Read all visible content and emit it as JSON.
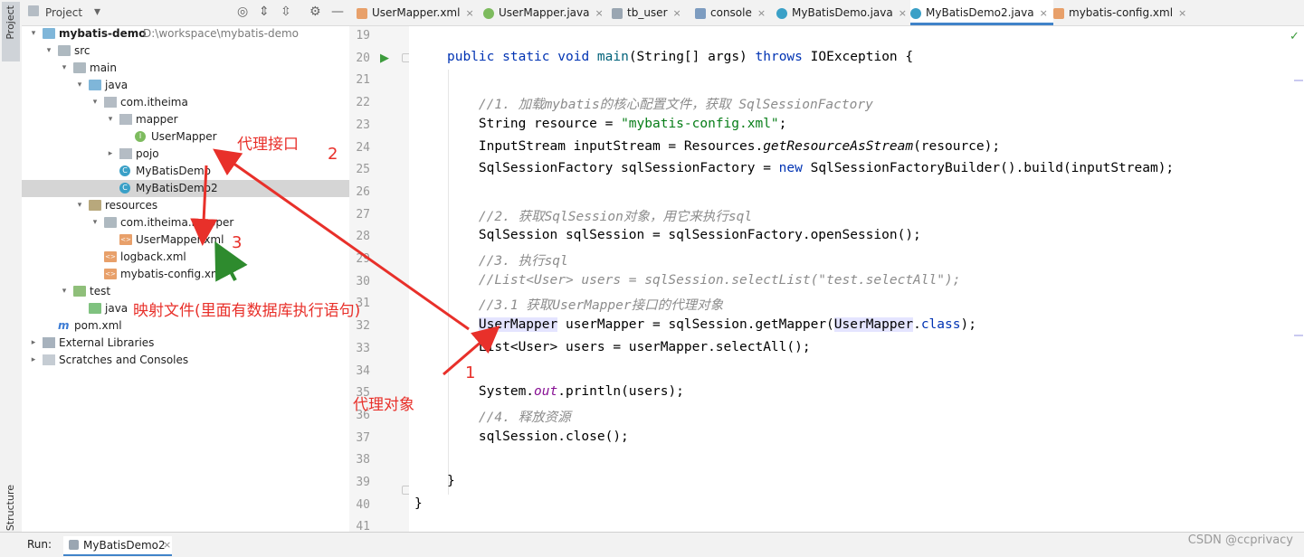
{
  "left_strip": {
    "project_label": "Project",
    "structure_label": "Structure"
  },
  "project_panel": {
    "title": "Project",
    "tree": [
      {
        "label": "mybatis-demo",
        "path": "D:\\workspace\\mybatis-demo",
        "depth": 0,
        "expanded": "open",
        "icon": "module-folder-icon"
      },
      {
        "label": "src",
        "depth": 1,
        "expanded": "open",
        "icon": "folder-icon"
      },
      {
        "label": "main",
        "depth": 2,
        "expanded": "open",
        "icon": "folder-icon"
      },
      {
        "label": "java",
        "depth": 3,
        "expanded": "open",
        "icon": "source-folder-icon"
      },
      {
        "label": "com.itheima",
        "depth": 4,
        "expanded": "open",
        "icon": "package-icon"
      },
      {
        "label": "mapper",
        "depth": 5,
        "expanded": "open",
        "icon": "package-icon"
      },
      {
        "label": "UserMapper",
        "depth": 6,
        "expanded": "none",
        "icon": "interface-icon"
      },
      {
        "label": "pojo",
        "depth": 5,
        "expanded": "closed",
        "icon": "package-icon"
      },
      {
        "label": "MyBatisDemo",
        "depth": 5,
        "expanded": "none",
        "icon": "class-icon"
      },
      {
        "label": "MyBatisDemo2",
        "depth": 5,
        "expanded": "none",
        "icon": "class-icon",
        "selected": true
      },
      {
        "label": "resources",
        "depth": 3,
        "expanded": "open",
        "icon": "resources-folder-icon"
      },
      {
        "label": "com.itheima.mapper",
        "depth": 4,
        "expanded": "open",
        "icon": "folder-icon"
      },
      {
        "label": "UserMapper.xml",
        "depth": 5,
        "expanded": "none",
        "icon": "xml-file-icon"
      },
      {
        "label": "logback.xml",
        "depth": 4,
        "expanded": "none",
        "icon": "xml-file-icon"
      },
      {
        "label": "mybatis-config.xml",
        "depth": 4,
        "expanded": "none",
        "icon": "xml-file-icon"
      },
      {
        "label": "test",
        "depth": 2,
        "expanded": "open",
        "icon": "test-folder-icon"
      },
      {
        "label": "java",
        "depth": 3,
        "expanded": "none",
        "icon": "test-source-folder-icon"
      },
      {
        "label": "pom.xml",
        "depth": 1,
        "expanded": "none",
        "icon": "maven-icon"
      },
      {
        "label": "External Libraries",
        "depth": 0,
        "expanded": "closed",
        "icon": "library-icon"
      },
      {
        "label": "Scratches and Consoles",
        "depth": 0,
        "expanded": "closed",
        "icon": "scratches-icon"
      }
    ]
  },
  "tabs": [
    {
      "label": "UserMapper.xml",
      "icon": "xml-file-icon",
      "color": "#e8a06a"
    },
    {
      "label": "UserMapper.java",
      "icon": "interface-icon",
      "color": "#7dbb5e"
    },
    {
      "label": "tb_user",
      "icon": "table-icon",
      "color": "#9aa6b2"
    },
    {
      "label": "console",
      "icon": "console-icon",
      "color": "#7d9cc0"
    },
    {
      "label": "MyBatisDemo.java",
      "icon": "class-icon",
      "color": "#3aa0c7"
    },
    {
      "label": "MyBatisDemo2.java",
      "icon": "class-icon",
      "color": "#3aa0c7",
      "active": true
    },
    {
      "label": "mybatis-config.xml",
      "icon": "xml-file-icon",
      "color": "#e8a06a"
    }
  ],
  "editor": {
    "line_numbers": [
      "19",
      "20",
      "21",
      "22",
      "23",
      "24",
      "25",
      "26",
      "27",
      "28",
      "29",
      "30",
      "31",
      "32",
      "33",
      "34",
      "35",
      "36",
      "37",
      "38",
      "39",
      "40",
      "41"
    ],
    "code_lines": [
      "",
      "public static void main(String[] args) throws IOException {",
      "",
      "    //1. 加载mybatis的核心配置文件，获取 SqlSessionFactory",
      "    String resource = \"mybatis-config.xml\";",
      "    InputStream inputStream = Resources.getResourceAsStream(resource);",
      "    SqlSessionFactory sqlSessionFactory = new SqlSessionFactoryBuilder().build(inputStream);",
      "",
      "    //2. 获取SqlSession对象，用它来执行sql",
      "    SqlSession sqlSession = sqlSessionFactory.openSession();",
      "    //3. 执行sql",
      "    //List<User> users = sqlSession.selectList(\"test.selectAll\");",
      "    //3.1 获取UserMapper接口的代理对象",
      "    UserMapper userMapper = sqlSession.getMapper(UserMapper.class);",
      "    List<User> users = userMapper.selectAll();",
      "",
      "    System.out.println(users);",
      "    //4. 释放资源",
      "    sqlSession.close();",
      "",
      "}",
      "}",
      ""
    ]
  },
  "run_bar": {
    "label": "Run:",
    "tab": "MyBatisDemo2"
  },
  "annotations": {
    "proxy_interface": "代理接口",
    "mapping_file": "映射文件(里面有数据库执行语句)",
    "proxy_object": "代理对象",
    "step1": "1",
    "step2": "2",
    "step3": "3"
  },
  "watermark": "CSDN @ccprivacy",
  "colors": {
    "annotation_red": "#e8302a",
    "annotation_green": "#2e8b2e",
    "active_tab": "#4083c9"
  }
}
